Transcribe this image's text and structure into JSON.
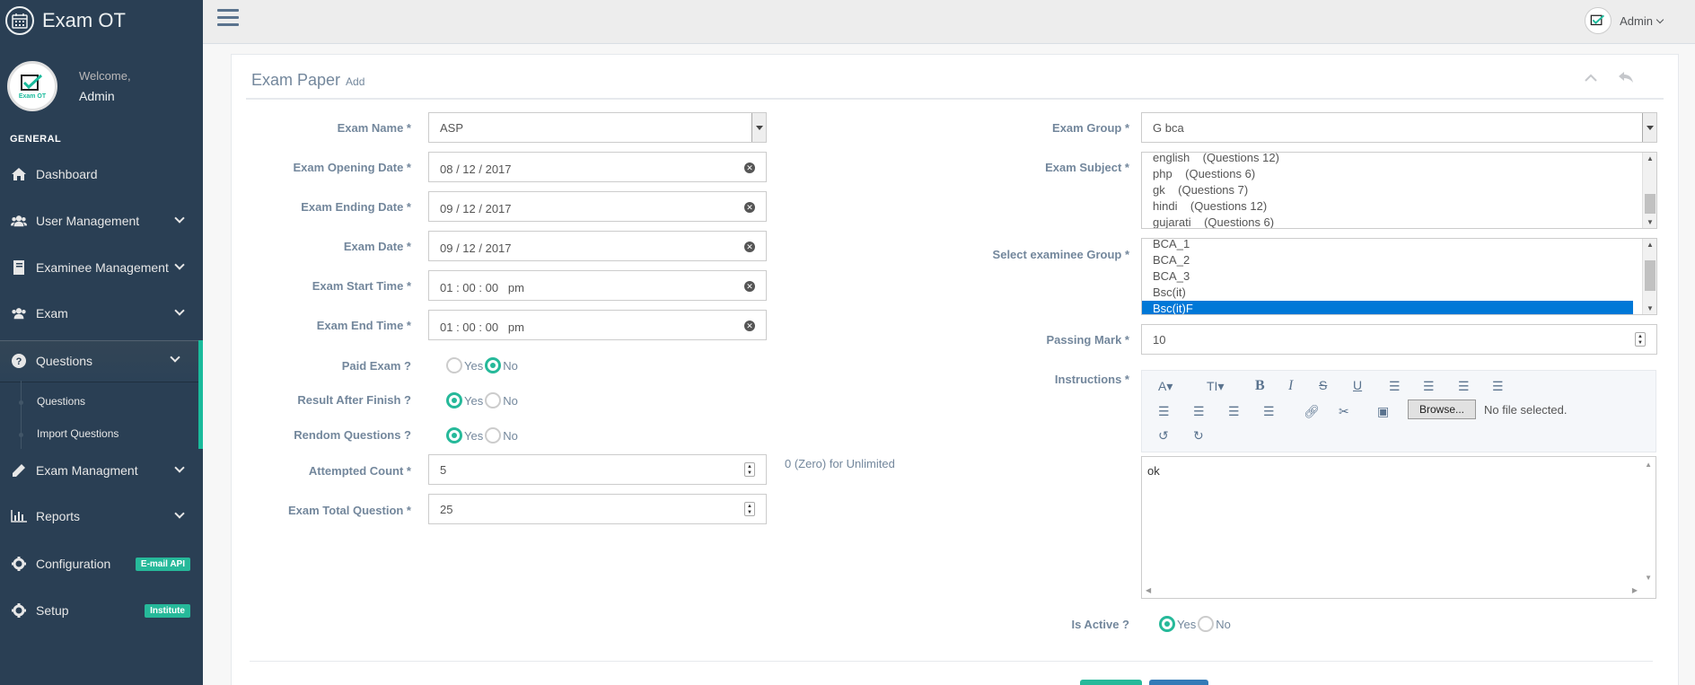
{
  "brand": {
    "title": "Exam OT",
    "avatar_text": "Exam OT"
  },
  "profile": {
    "welcome": "Welcome,",
    "name": "Admin"
  },
  "sidebar": {
    "section": "GENERAL",
    "items": [
      {
        "label": "Dashboard"
      },
      {
        "label": "User Management"
      },
      {
        "label": "Examinee Management"
      },
      {
        "label": "Exam"
      },
      {
        "label": "Questions"
      },
      {
        "label": "Exam Managment"
      },
      {
        "label": "Reports"
      },
      {
        "label": "Configuration",
        "badge": "E-mail API"
      },
      {
        "label": "Setup",
        "badge": "Institute"
      }
    ],
    "submenu": [
      {
        "label": "Questions"
      },
      {
        "label": "Import Questions"
      }
    ]
  },
  "topbar": {
    "user": "Admin"
  },
  "panel": {
    "title": "Exam Paper",
    "subtitle": "Add"
  },
  "form": {
    "exam_name": {
      "label": "Exam Name *",
      "value": "ASP"
    },
    "opening_date": {
      "label": "Exam Opening Date *",
      "value": "08 / 12 / 2017"
    },
    "ending_date": {
      "label": "Exam Ending Date *",
      "value": "09 / 12 / 2017"
    },
    "exam_date": {
      "label": "Exam Date *",
      "value": "09 / 12 / 2017"
    },
    "start_time": {
      "label": "Exam Start Time *",
      "value": "01 : 00 : 00   pm"
    },
    "end_time": {
      "label": "Exam End Time *",
      "value": "01 : 00 : 00   pm"
    },
    "paid_exam": {
      "label": "Paid Exam ?",
      "yes": "Yes",
      "no": "No",
      "selected": "No"
    },
    "result_after_finish": {
      "label": "Result After Finish ?",
      "yes": "Yes",
      "no": "No",
      "selected": "Yes"
    },
    "random_questions": {
      "label": "Rendom Questions ?",
      "yes": "Yes",
      "no": "No",
      "selected": "Yes"
    },
    "attempted_count": {
      "label": "Attempted Count *",
      "value": "5",
      "hint": "0 (Zero) for Unlimited"
    },
    "total_questions": {
      "label": "Exam Total Question *",
      "value": "25"
    },
    "exam_group": {
      "label": "Exam Group *",
      "value": "G bca"
    },
    "exam_subject": {
      "label": "Exam Subject *",
      "options": [
        "english    (Questions 12)",
        "php    (Questions 6)",
        "gk    (Questions 7)",
        "hindi    (Questions 12)",
        "gujarati    (Questions 6)"
      ]
    },
    "examinee_group": {
      "label": "Select examinee Group *",
      "options": [
        "BCA_1",
        "BCA_2",
        "BCA_3",
        "Bsc(it)",
        "Bsc(it)F"
      ],
      "selected": "Bsc(it)F"
    },
    "passing_mark": {
      "label": "Passing Mark *",
      "value": "10"
    },
    "instructions": {
      "label": "Instructions *",
      "value": "ok",
      "browse_label": "Browse...",
      "file_status": "No file selected."
    },
    "is_active": {
      "label": "Is Active ?",
      "yes": "Yes",
      "no": "No",
      "selected": "Yes"
    }
  },
  "colors": {
    "sidebar": "#2A3F54",
    "accent": "#1ABB9C",
    "badge": "#26B99A",
    "selected_option": "#0078D7"
  }
}
